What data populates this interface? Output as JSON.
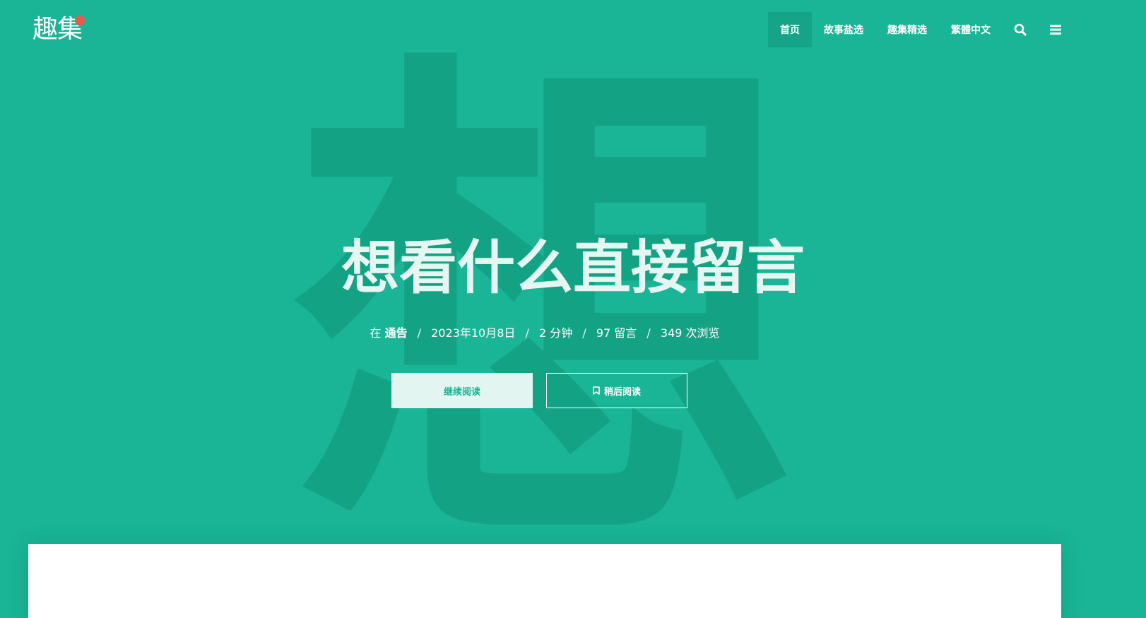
{
  "site": {
    "logo_text": "趣集"
  },
  "nav": {
    "items": [
      {
        "label": "首页",
        "active": true
      },
      {
        "label": "故事盐选",
        "active": false
      },
      {
        "label": "趣集精选",
        "active": false
      },
      {
        "label": "繁體中文",
        "active": false
      }
    ],
    "search_icon": "search-icon",
    "menu_icon": "hamburger-menu-icon"
  },
  "hero": {
    "watermark_char": "想",
    "title": "想看什么直接留言",
    "meta": {
      "category_prefix": "在",
      "category": "通告",
      "date": "2023年10月8日",
      "read_time": "2 分钟",
      "comments": "97 留言",
      "views": "349 次浏览",
      "separator": "/"
    },
    "buttons": {
      "continue": "继续阅读",
      "read_later": "稍后阅读",
      "read_later_icon": "bookmark-icon"
    }
  },
  "colors": {
    "background": "#19b596",
    "watermark": "#149f82",
    "active_nav": "#15a487",
    "logo_dot": "#e85a4a"
  }
}
